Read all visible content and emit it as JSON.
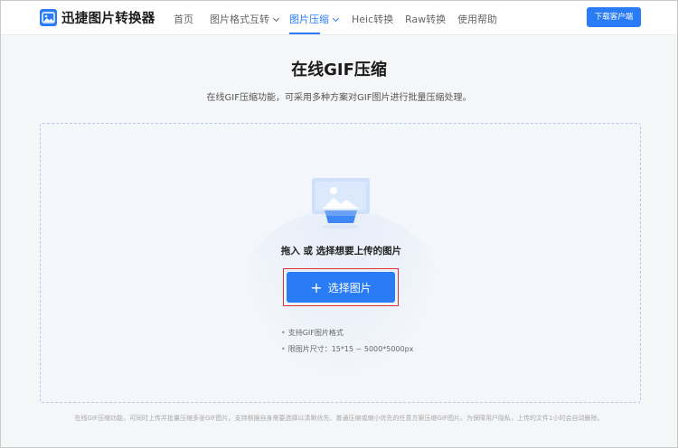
{
  "header": {
    "brand": "迅捷图片转换器",
    "nav": [
      {
        "label": "首页",
        "active": false,
        "has_dropdown": false
      },
      {
        "label": "图片格式互转",
        "active": false,
        "has_dropdown": true
      },
      {
        "label": "图片压缩",
        "active": true,
        "has_dropdown": true
      },
      {
        "label": "Heic转换",
        "active": false,
        "has_dropdown": false
      },
      {
        "label": "Raw转换",
        "active": false,
        "has_dropdown": false
      },
      {
        "label": "使用帮助",
        "active": false,
        "has_dropdown": false
      }
    ],
    "download_label": "下载客户端"
  },
  "page": {
    "title": "在线GIF压缩",
    "subtitle": "在线GIF压缩功能，可采用多种方案对GIF图片进行批量压缩处理。"
  },
  "upload": {
    "hint": "拖入 或 选择想要上传的图片",
    "button_label": "选择图片",
    "notes": [
      "支持GIF图片格式",
      "限图片尺寸：15*15 ~ 5000*5000px"
    ]
  },
  "footer": {
    "text": "在线GIF压缩功能，可同时上传并批量压缩多张GIF图片。支持根据自身需要选择以清晰优先、普通压缩或缩小优先的任意方案压缩GIF图片。为保障用户隐私，上传的文件1小时会自动删除。"
  },
  "colors": {
    "accent": "#2a7cf6",
    "highlight": "#e03131"
  },
  "icons": {
    "logo": "image-logo-icon",
    "upload": "image-upload-illustration",
    "plus": "plus-icon",
    "chevron": "chevron-down-icon"
  }
}
